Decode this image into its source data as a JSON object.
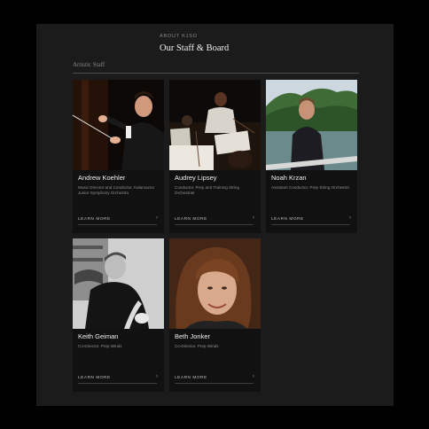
{
  "header": {
    "eyebrow": "ABOUT KJSO",
    "title": "Our Staff & Board"
  },
  "section": {
    "label": "Artistic Staff"
  },
  "cards": [
    {
      "name": "Andrew Koehler",
      "role": "Music Director and Conductor, Kalamazoo Junior Symphony Orchestra",
      "link": "LEARN MORE",
      "chevron": "›"
    },
    {
      "name": "Audrey Lipsey",
      "role": "Conductor, Prep and Training String Orchestras",
      "link": "LEARN MORE",
      "chevron": "›"
    },
    {
      "name": "Noah Krzan",
      "role": "Assistant Conductor, Prep String Orchestra",
      "link": "LEARN MORE",
      "chevron": "›"
    },
    {
      "name": "Keith Geiman",
      "role": "Co-Director, Prep Winds",
      "link": "LEARN MORE",
      "chevron": "›"
    },
    {
      "name": "Beth Jonker",
      "role": "Co-Director, Prep Winds",
      "link": "LEARN MORE",
      "chevron": "›"
    }
  ]
}
